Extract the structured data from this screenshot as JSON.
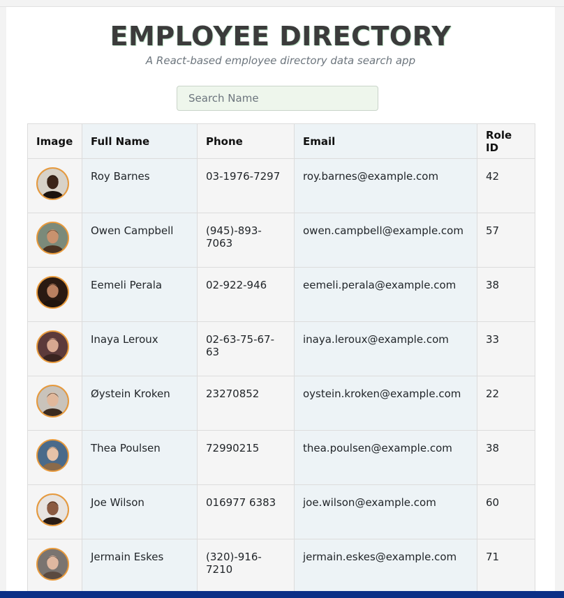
{
  "header": {
    "title": "EMPLOYEE DIRECTORY",
    "subtitle": "A React-based employee directory data search app"
  },
  "search": {
    "placeholder": "Search Name",
    "value": ""
  },
  "table": {
    "columns": [
      "Image",
      "Full Name",
      "Phone",
      "Email",
      "Role ID"
    ],
    "rows": [
      {
        "name": "Roy Barnes",
        "phone": "03-1976-7297",
        "email": "roy.barnes@example.com",
        "role": "42",
        "skin": "#3b2418",
        "bg": "#d8d2c8",
        "hair": "#1a120e"
      },
      {
        "name": "Owen Campbell",
        "phone": "(945)-893-7063",
        "email": "owen.campbell@example.com",
        "role": "57",
        "skin": "#c9926e",
        "bg": "#7b8a7a",
        "hair": "#4a3322"
      },
      {
        "name": "Eemeli Perala",
        "phone": "02-922-946",
        "email": "eemeli.perala@example.com",
        "role": "38",
        "skin": "#b98060",
        "bg": "#2a1a12",
        "hair": "#1e140e"
      },
      {
        "name": "Inaya Leroux",
        "phone": "02-63-75-67-63",
        "email": "inaya.leroux@example.com",
        "role": "33",
        "skin": "#d8a890",
        "bg": "#5c3a3a",
        "hair": "#3a2420"
      },
      {
        "name": "Øystein Kroken",
        "phone": "23270852",
        "email": "oystein.kroken@example.com",
        "role": "22",
        "skin": "#e0b89c",
        "bg": "#c9c3bb",
        "hair": "#3b2b20"
      },
      {
        "name": "Thea Poulsen",
        "phone": "72990215",
        "email": "thea.poulsen@example.com",
        "role": "38",
        "skin": "#e6c2a8",
        "bg": "#4a6a8a",
        "hair": "#8a6a4a"
      },
      {
        "name": "Joe Wilson",
        "phone": "016977 6383",
        "email": "joe.wilson@example.com",
        "role": "60",
        "skin": "#8a5a40",
        "bg": "#e8e4e0",
        "hair": "#2a1c14"
      },
      {
        "name": "Jermain Eskes",
        "phone": "(320)-916-7210",
        "email": "jermain.eskes@example.com",
        "role": "71",
        "skin": "#e0b8a0",
        "bg": "#7a7470",
        "hair": "#5a4a40"
      }
    ]
  },
  "colors": {
    "accent_border": "#e89a3c",
    "footer_bar": "#0b2f86"
  }
}
